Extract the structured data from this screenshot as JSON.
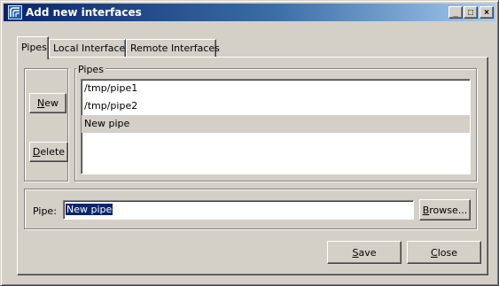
{
  "window": {
    "title": "Add new interfaces",
    "minimize": "_",
    "maximize": "□",
    "close": "×"
  },
  "tabs": [
    {
      "label": "Pipes",
      "active": true
    },
    {
      "label": "Local Interfaces",
      "active": false
    },
    {
      "label": "Remote Interfaces",
      "active": false
    }
  ],
  "pipes_group": {
    "label": "Pipes",
    "new_button": {
      "mnemonic": "N",
      "rest": "ew"
    },
    "delete_button": {
      "mnemonic": "D",
      "rest": "elete"
    },
    "items": [
      {
        "label": "/tmp/pipe1",
        "selected": false
      },
      {
        "label": "/tmp/pipe2",
        "selected": false
      },
      {
        "label": "New pipe",
        "selected": true
      }
    ]
  },
  "pipe_field": {
    "label": "Pipe:",
    "value": "New pipe",
    "browse": {
      "mnemonic": "B",
      "rest": "rowse..."
    }
  },
  "footer": {
    "save": {
      "mnemonic": "S",
      "rest": "ave"
    },
    "close": {
      "mnemonic": "C",
      "rest": "lose"
    }
  },
  "colors": {
    "face": "#d4d0c8",
    "title_start": "#0a246a",
    "title_end": "#a6caf0",
    "selection": "#0a246a"
  },
  "icons": [
    "app-wave-icon"
  ]
}
